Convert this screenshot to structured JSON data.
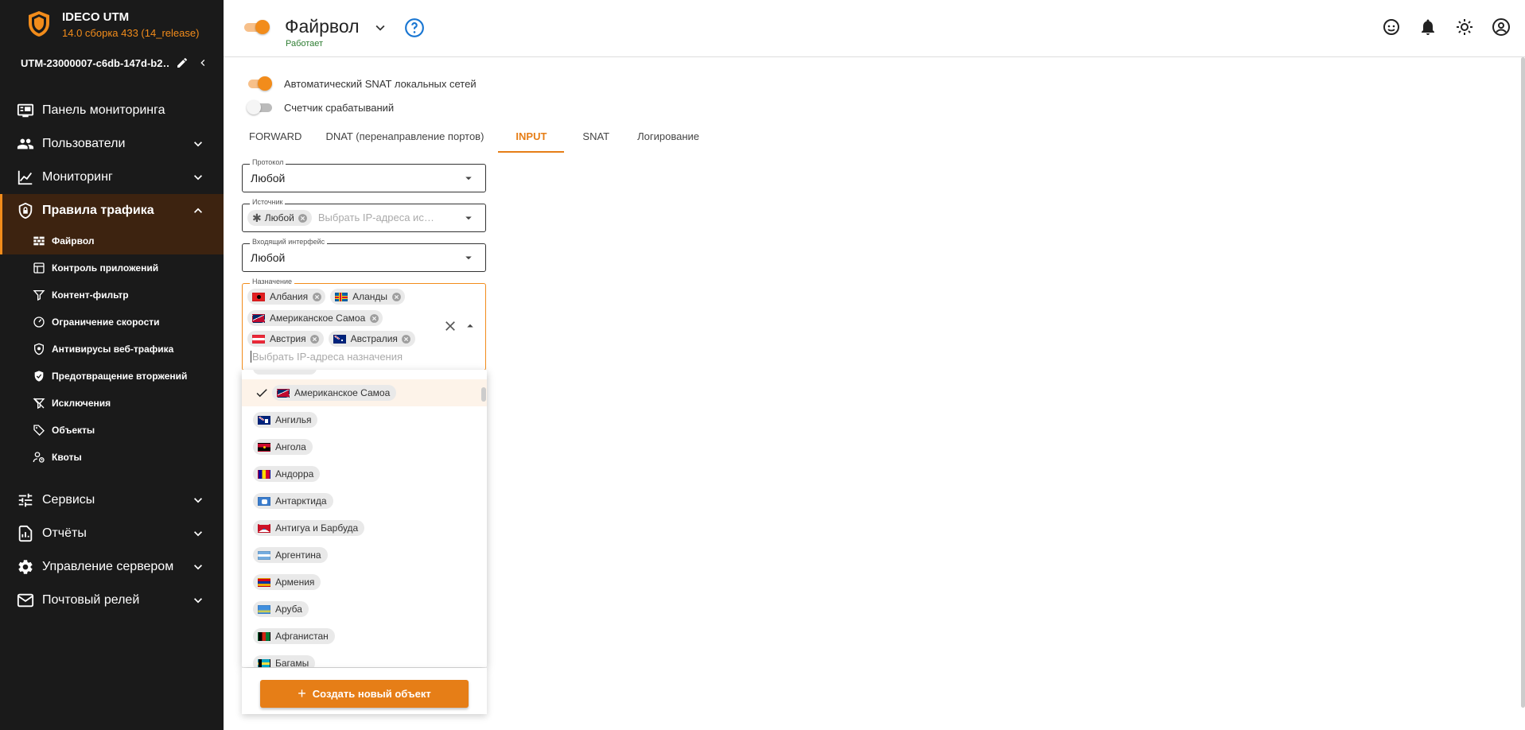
{
  "brand": {
    "name": "IDECO UTM",
    "version": "14.0 сборка 433 (14_release)"
  },
  "device": {
    "name": "UTM-23000007-c6db-147d-b2…"
  },
  "nav": {
    "monitoring_panel": "Панель мониторинга",
    "users": "Пользователи",
    "monitoring": "Мониторинг",
    "traffic_rules": "Правила трафика",
    "services": "Сервисы",
    "reports": "Отчёты",
    "server_mgmt": "Управление сервером",
    "mail_relay": "Почтовый релей"
  },
  "subnav": {
    "firewall": "Файрвол",
    "app_control": "Контроль приложений",
    "content_filter": "Контент-фильтр",
    "speed_limit": "Ограничение скорости",
    "web_antivirus": "Антивирусы веб-трафика",
    "ips": "Предотвращение вторжений",
    "exceptions": "Исключения",
    "objects": "Объекты",
    "quotas": "Квоты"
  },
  "header": {
    "title": "Файрвол",
    "status": "Работает",
    "enabled": true
  },
  "switches": {
    "snat_label": "Автоматический SNAT локальных сетей",
    "snat_on": true,
    "counter_label": "Счетчик срабатываний",
    "counter_on": false
  },
  "tabs": [
    "FORWARD",
    "DNAT (перенаправление портов)",
    "INPUT",
    "SNAT",
    "Логирование"
  ],
  "active_tab": "INPUT",
  "form": {
    "protocol": {
      "label": "Протокол",
      "value": "Любой"
    },
    "source": {
      "label": "Источник",
      "chip": "Любой",
      "placeholder": "Выбрать IP-адреса ис…"
    },
    "iface": {
      "label": "Входящий интерфейс",
      "value": "Любой"
    },
    "dest": {
      "label": "Назначение",
      "chips": [
        "Албания",
        "Аланды",
        "Американское Самоа",
        "Австрия",
        "Австралия"
      ],
      "placeholder": "Выбрать IP-адреса назначения"
    }
  },
  "dropdown": {
    "items": [
      {
        "label": "Американское Самоа",
        "selected": true
      },
      {
        "label": "Ангилья",
        "selected": false
      },
      {
        "label": "Ангола",
        "selected": false
      },
      {
        "label": "Андорра",
        "selected": false
      },
      {
        "label": "Антарктида",
        "selected": false
      },
      {
        "label": "Антигуа и Барбуда",
        "selected": false
      },
      {
        "label": "Аргентина",
        "selected": false
      },
      {
        "label": "Армения",
        "selected": false
      },
      {
        "label": "Аруба",
        "selected": false
      },
      {
        "label": "Афганистан",
        "selected": false
      },
      {
        "label": "Багамы",
        "selected": false
      }
    ],
    "create_label": "Создать новый объект"
  },
  "colors": {
    "accent": "#f28c1b",
    "sidebar_bg": "#1a1a1a",
    "active_bg": "#3d2310",
    "status": "#2e7d32",
    "help": "#1976d2"
  }
}
